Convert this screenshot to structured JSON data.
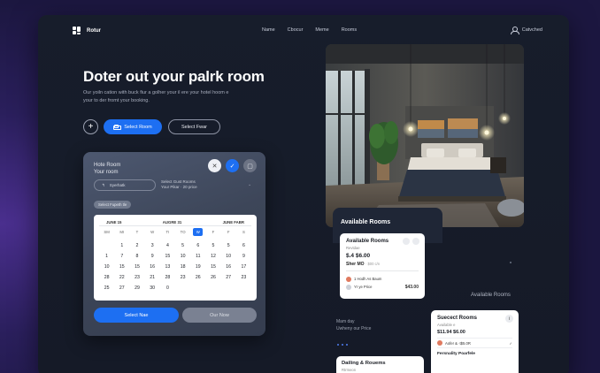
{
  "brand": {
    "name": "Rotur"
  },
  "nav": {
    "items": [
      "Name",
      "Cbocur",
      "Meme",
      "Rooms"
    ]
  },
  "account": {
    "label": "Catvched"
  },
  "hero": {
    "title": "Doter out your palrk room",
    "subtitle": "Our yoiln cation with buck fiur a golher your il ere your hotel hoom e your to der fromt your booking.",
    "plus": "+",
    "primary_button": "Select Room",
    "secondary_button": "Select Fwar"
  },
  "booking": {
    "title_line1": "Hote Room",
    "title_line2": "Your room",
    "icon_buttons": {
      "close": "✕",
      "confirm": "✓",
      "lock": "▢"
    },
    "guest_pill": "Syerhatk",
    "guest_select": "Select Gust Rooms",
    "guest_select_sub": "Your Pikar · 20 price",
    "select_date": "Select Fupeth tle",
    "calendar": {
      "months": [
        "JUNE 15",
        "AUGRE 31",
        "JUNE FABR"
      ],
      "weekdays": [
        "SM",
        "MI",
        "T",
        "W",
        "TI",
        "TO",
        "W",
        "F",
        "F",
        "S"
      ],
      "weeks": [
        [
          "",
          "",
          "",
          "",
          "",
          "",
          "",
          "",
          "",
          ""
        ],
        [
          "",
          "1",
          "2",
          "3",
          "4",
          "5",
          "6",
          "5",
          "5",
          "6"
        ],
        [
          "1",
          "7",
          "8",
          "9",
          "15",
          "10",
          "11",
          "12",
          "10",
          "9"
        ],
        [
          "10",
          "15",
          "15",
          "16",
          "13",
          "18",
          "19",
          "15",
          "16",
          "17"
        ],
        [
          "28",
          "22",
          "23",
          "21",
          "28",
          "23",
          "26",
          "26",
          "27",
          "23"
        ],
        [
          "25",
          "27",
          "29",
          "30",
          "0",
          "",
          "",
          "",
          "",
          ""
        ]
      ],
      "highlighted": "W"
    },
    "primary_button": "Select Nae",
    "secondary_button": "Our Now"
  },
  "available": {
    "title": "Available Rooms",
    "card1": {
      "title": "Available Rooms",
      "subtitle": "Revtdae",
      "price": "$.4 $6.00",
      "price2": "Sher  MO",
      "price2_note": "· $00 c/n",
      "line1": "1 Hodh As Baum",
      "line2": "Yr ye Price",
      "amount": "$43.00"
    },
    "right_label": "Available Rooms",
    "more": {
      "line1": "Mam day",
      "line2": "Uwheny our Price"
    },
    "card2": {
      "title": "Suecect Rooms",
      "subtitle": "Available e",
      "price": "$11.94 $6.00",
      "line": "Aofer  & ·t$5.0R",
      "footer": "Fersnality Poarfele"
    },
    "card3": {
      "title": "Dailing & Rouems",
      "subtitle": "Rtrmeon"
    }
  },
  "colors": {
    "accent": "#1d6ff2",
    "frame": "#171d2b",
    "background": "#2a1f5c"
  }
}
